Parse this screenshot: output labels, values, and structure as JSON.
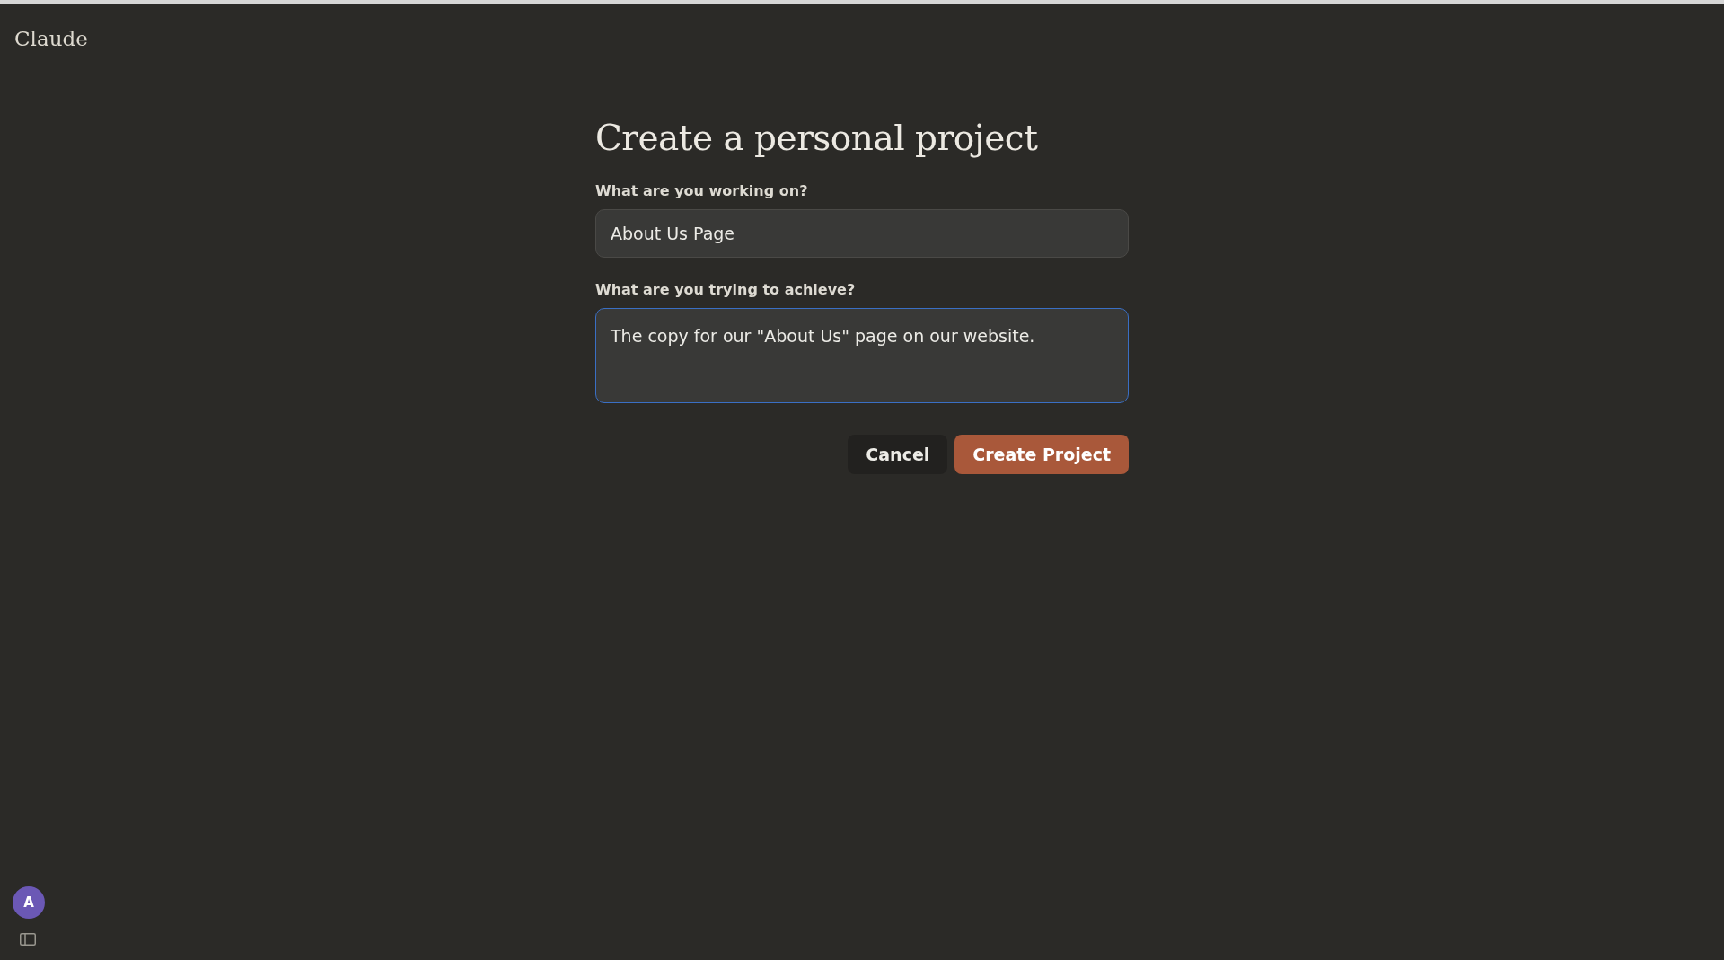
{
  "app": {
    "logo": "Claude"
  },
  "form": {
    "title": "Create a personal project",
    "fields": [
      {
        "kind": "input",
        "label": "What are you working on?",
        "value": "About Us Page",
        "focused": false
      },
      {
        "kind": "textarea",
        "label": "What are you trying to achieve?",
        "value": "The copy for our \"About Us\" page on our website.",
        "focused": true
      }
    ],
    "buttons": [
      {
        "kind": "secondary",
        "label": "Cancel"
      },
      {
        "kind": "primary",
        "label": "Create Project"
      }
    ]
  },
  "sidebar": {
    "avatar": "A"
  }
}
